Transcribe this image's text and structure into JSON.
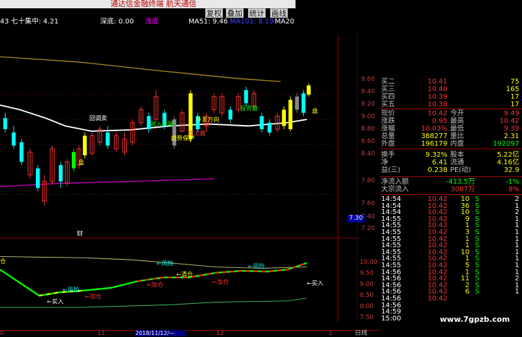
{
  "window": {
    "title": "通达信金融终端 航天通信"
  },
  "toolbar": {
    "buttons": [
      "复权",
      "叠加",
      "统计",
      "画线"
    ]
  },
  "infobar": {
    "prefix": "43",
    "name": "七十集中: 4.21",
    "deep_label": "深底: 0.00",
    "shallow_label": "浅底",
    "ma51": "MA51: 9.46",
    "ma101": "MA101: 8.19",
    "ma20": "MA20"
  },
  "price_axis": {
    "labels": [
      "9.60",
      "9.40",
      "9.20",
      "9.00",
      "8.80",
      "8.60",
      "8.40",
      "7.80",
      "7.60",
      "7.40",
      "7.20"
    ],
    "highlight": "7.30"
  },
  "indicator_axis": {
    "labels": [
      "10.00",
      "9.50",
      "9.00",
      "8.50",
      "8.00",
      "7.50"
    ]
  },
  "chart_annotations": {
    "pullback": "回调卖",
    "jinrukaixiang": "进入开箱",
    "zuoshang": "左上盘",
    "pan1": "盘",
    "pan2": "盘",
    "baohu": "趋势保护",
    "shengfaqiang": "升发方向",
    "touqing": "投资盘",
    "wei": "财"
  },
  "indicator_labels": {
    "risk1": "←风险",
    "risk2": "←风险",
    "risk3": "←风险",
    "buy1": "←买入",
    "buy2": "←买入",
    "add1": "←加仓",
    "add2": "←加仓",
    "add3": "←加仓",
    "clear": "←清仓",
    "cang": "仓"
  },
  "xaxis": {
    "labels": [
      "0",
      "11",
      "2018/11/12/—",
      "12",
      "1",
      "日线"
    ]
  },
  "quote": {
    "asks": [
      {
        "label": "买二",
        "price": "10.41",
        "vol": "75"
      },
      {
        "label": "买三",
        "price": "10.40",
        "vol": "165"
      },
      {
        "label": "买四",
        "price": "10.39",
        "vol": "17"
      },
      {
        "label": "买五",
        "price": "10.38",
        "vol": "17"
      }
    ],
    "stats": [
      {
        "l1": "现价",
        "v1": "10.42",
        "l2": "今开",
        "v2": "9.49"
      },
      {
        "l1": "涨跌",
        "v1": "0.95",
        "l2": "最高",
        "v2": "10.42"
      },
      {
        "l1": "涨幅",
        "v1": "10.03%",
        "l2": "最低",
        "v2": "9.39"
      },
      {
        "l1": "总量",
        "v1": "388277",
        "l2": "量比",
        "v2": "2.31"
      },
      {
        "l1": "外盘",
        "v1": "196179",
        "l2": "内盘",
        "v2": "192097"
      }
    ],
    "stats2": [
      {
        "l1": "换手",
        "v1": "9.32%",
        "l2": "股本",
        "v2": "5.22亿"
      },
      {
        "l1": "净",
        "v1": "6.41",
        "l2": "流通",
        "v2": "4.16亿"
      },
      {
        "l1": "益(三)",
        "v1": "0.238",
        "l2": "PE(动)",
        "v2": "32.9"
      }
    ],
    "flow": [
      {
        "label": "净流入额",
        "value": "-413.5万",
        "pct": "-1%"
      },
      {
        "label": "大宗流入",
        "value": "3087万",
        "pct": "8%"
      }
    ],
    "ticks": [
      {
        "time": "14:54",
        "price": "10.42",
        "vol": "10",
        "side": "S",
        "num": "2"
      },
      {
        "time": "14:54",
        "price": "10.42",
        "vol": "36",
        "side": "S",
        "num": "1"
      },
      {
        "time": "14:54",
        "price": "10.42",
        "vol": "10",
        "side": "S",
        "num": "2"
      },
      {
        "time": "14:55",
        "price": "10.42",
        "vol": "9",
        "side": "S",
        "num": "1"
      },
      {
        "time": "14:55",
        "price": "10.42",
        "vol": "1",
        "side": "S",
        "num": "1"
      },
      {
        "time": "14:55",
        "price": "10.42",
        "vol": "3",
        "side": "S",
        "num": "1"
      },
      {
        "time": "14:55",
        "price": "10.42",
        "vol": "1",
        "side": "S",
        "num": "1"
      },
      {
        "time": "14:55",
        "price": "10.42",
        "vol": "1",
        "side": "S",
        "num": "1"
      },
      {
        "time": "14:55",
        "price": "10.42",
        "vol": "10",
        "side": "S",
        "num": "1"
      },
      {
        "time": "14:55",
        "price": "10.42",
        "vol": "1",
        "side": "S",
        "num": "1"
      },
      {
        "time": "14:55",
        "price": "10.42",
        "vol": "5",
        "side": "S",
        "num": "1"
      },
      {
        "time": "14:56",
        "price": "10.42",
        "vol": "1",
        "side": "S",
        "num": "1"
      },
      {
        "time": "14:56",
        "price": "10.42",
        "vol": "11",
        "side": "S",
        "num": "2"
      },
      {
        "time": "14:56",
        "price": "10.42",
        "vol": "2",
        "side": "S",
        "num": "1"
      },
      {
        "time": "14:56",
        "price": "10.42",
        "vol": "6",
        "side": "S",
        "num": "1"
      },
      {
        "time": "14:56",
        "price": "10.42",
        "vol": "",
        "side": "",
        "num": ""
      },
      {
        "time": "14:56",
        "price": "",
        "vol": "",
        "side": "",
        "num": ""
      },
      {
        "time": "14:59",
        "price": "",
        "vol": "",
        "side": "",
        "num": ""
      },
      {
        "time": "15:00",
        "price": "",
        "vol": "",
        "side": "",
        "num": ""
      }
    ],
    "watermark": "www.7gpzb.com"
  },
  "colors": {
    "up": "#ff3030",
    "down": "#00ffff",
    "yellow": "#ffff00",
    "green": "#00ff00",
    "white": "#ffffff",
    "magenta": "#ff00ff"
  }
}
